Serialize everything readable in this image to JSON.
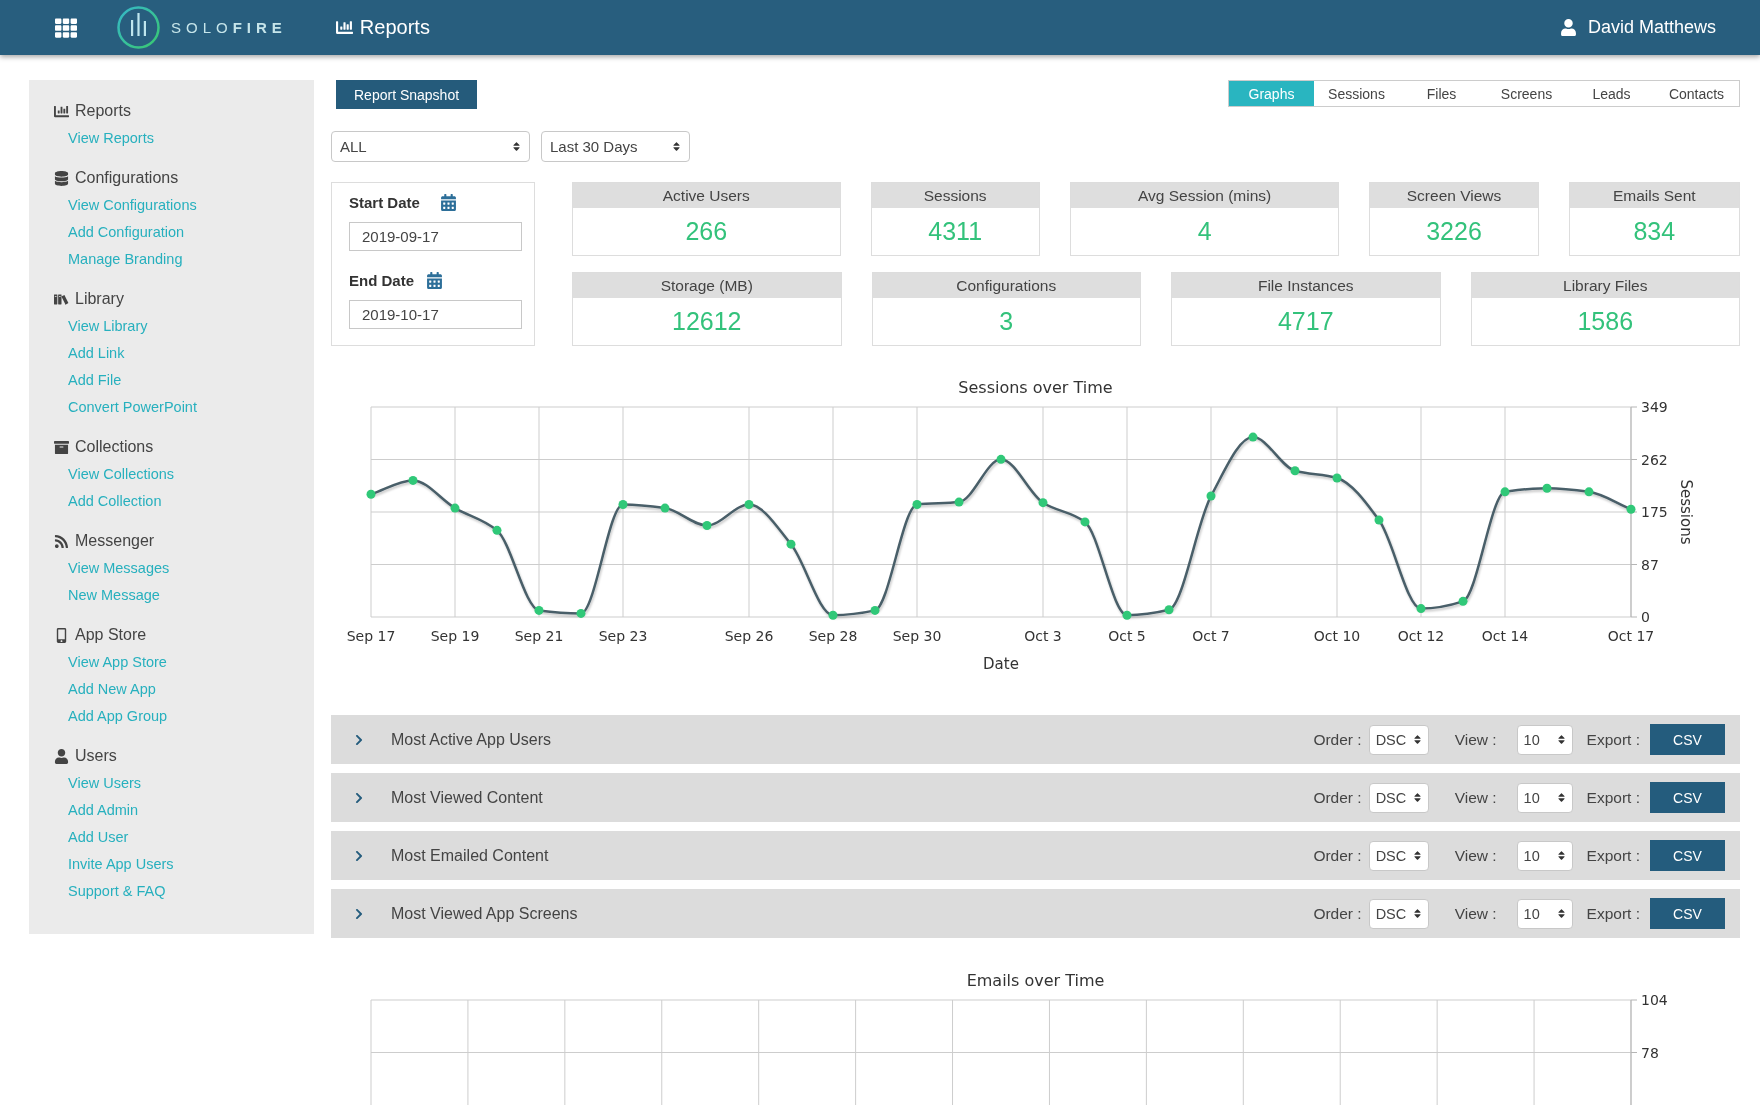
{
  "app_bar": {
    "logo": "SOLO**FIRE**",
    "page_title": "Reports",
    "user_name": "David Matthews"
  },
  "sidebar": {
    "sections": [
      {
        "title": "Reports",
        "links": [
          "View Reports"
        ]
      },
      {
        "title": "Configurations",
        "links": [
          "View Configurations",
          "Add Configuration",
          "Manage Branding"
        ]
      },
      {
        "title": "Library",
        "links": [
          "View Library",
          "Add Link",
          "Add File",
          "Convert PowerPoint"
        ]
      },
      {
        "title": "Collections",
        "links": [
          "View Collections",
          "Add Collection"
        ]
      },
      {
        "title": "Messenger",
        "links": [
          "View Messages",
          "New Message"
        ]
      },
      {
        "title": "App Store",
        "links": [
          "View App Store",
          "Add New App",
          "Add App Group"
        ]
      },
      {
        "title": "Users",
        "links": [
          "View Users",
          "Add Admin",
          "Add User",
          "Invite App Users",
          "Support & FAQ"
        ]
      }
    ]
  },
  "toolbar": {
    "snapshot_button": "Report Snapshot",
    "tabs": [
      {
        "label": "Graphs",
        "selected": true
      },
      {
        "label": "Sessions",
        "selected": false
      },
      {
        "label": "Files",
        "selected": false
      },
      {
        "label": "Screens",
        "selected": false
      },
      {
        "label": "Leads",
        "selected": false
      },
      {
        "label": "Contacts",
        "selected": false
      }
    ]
  },
  "filters": [
    {
      "value": "ALL"
    },
    {
      "value": "Last 30 Days"
    }
  ],
  "date_range": [
    {
      "label": "Start Date",
      "value": "2019-09-17"
    },
    {
      "label": "End Date",
      "value": "2019-10-17"
    }
  ],
  "stat_rows": [
    {
      "cards": [
        {
          "label": "Active Users",
          "value": "266"
        },
        {
          "label": "Sessions",
          "value": "4311"
        },
        {
          "label": "Avg Session (mins)",
          "value": "4"
        },
        {
          "label": "Screen Views",
          "value": "3226"
        },
        {
          "label": "Emails Sent",
          "value": "834"
        }
      ]
    },
    {
      "cards": [
        {
          "label": "Storage (MB)",
          "value": "12612"
        },
        {
          "label": "Configurations",
          "value": "3"
        },
        {
          "label": "File Instances",
          "value": "4717"
        },
        {
          "label": "Library Files",
          "value": "1586"
        }
      ]
    }
  ],
  "sessions_chart": {
    "chart_data": {
      "type": "line",
      "title": "Sessions over Time",
      "xlabel": "Date",
      "ylabel": "Sessions",
      "grid": true,
      "categories": [
        "Sep 17",
        null,
        "Sep 19",
        null,
        "Sep 21",
        null,
        "Sep 23",
        null,
        null,
        "Sep 26",
        null,
        "Sep 28",
        null,
        "Sep 30",
        null,
        null,
        "Oct 3",
        null,
        "Oct 5",
        null,
        "Oct 7",
        null,
        null,
        "Oct 10",
        null,
        "Oct 12",
        null,
        "Oct 14",
        null,
        null,
        "Oct 17"
      ],
      "series": [
        {
          "color": "#4a5f69",
          "marker": true,
          "values": [
            204,
            227,
            181,
            144,
            11,
            6,
            187,
            181,
            152,
            187,
            121,
            3,
            11,
            187,
            191,
            262,
            190,
            158,
            3,
            12,
            201,
            299,
            243,
            231,
            161,
            14,
            26,
            208,
            214,
            208,
            179
          ]
        }
      ],
      "ylim": [
        0,
        349
      ],
      "yticks": [
        0,
        {
          "value": 87.25,
          "label": "87"
        },
        {
          "value": 174.5,
          "label": "175"
        },
        {
          "value": 261.75,
          "label": "262"
        },
        349
      ]
    }
  },
  "reports": [
    {
      "title": "Most Active App Users",
      "expanded": false,
      "order_label": "Order :",
      "order": "DSC",
      "view_label": "View :",
      "view": "10",
      "export_label": "Export :",
      "export_button": "CSV"
    },
    {
      "title": "Most Viewed Content",
      "expanded": false,
      "order_label": "Order :",
      "order": "DSC",
      "view_label": "View :",
      "view": "10",
      "export_label": "Export :",
      "export_button": "CSV"
    },
    {
      "title": "Most Emailed Content",
      "expanded": false,
      "order_label": "Order :",
      "order": "DSC",
      "view_label": "View :",
      "view": "10",
      "export_label": "Export :",
      "export_button": "CSV"
    },
    {
      "title": "Most Viewed App Screens",
      "expanded": false,
      "order_label": "Order :",
      "order": "DSC",
      "view_label": "View :",
      "view": "10",
      "export_label": "Export :",
      "export_button": "CSV"
    }
  ],
  "emails_chart": {
    "chart_data": {
      "type": "line",
      "title": "Emails over Time",
      "grid": true,
      "categories": [
        null,
        null,
        null,
        null,
        null,
        null,
        null,
        null,
        null,
        null,
        null,
        null,
        null,
        null,
        null,
        null,
        null,
        null,
        null,
        null,
        null,
        null,
        null,
        null,
        null,
        null,
        null,
        null,
        null,
        null,
        null
      ],
      "ylim": [
        52,
        104
      ],
      "yticks": [
        104,
        78
      ]
    }
  }
}
